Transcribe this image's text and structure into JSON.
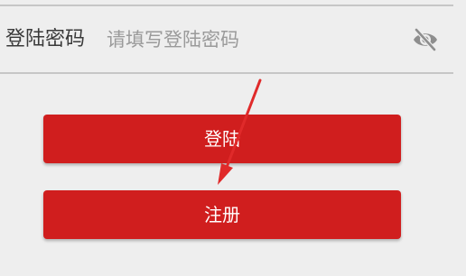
{
  "password_row": {
    "label": "登陆密码",
    "input_value": "",
    "placeholder": "请填写登陆密码",
    "toggle_icon": "eye-off-icon"
  },
  "buttons": {
    "login_label": "登陆",
    "register_label": "注册"
  },
  "annotation": {
    "icon": "red-arrow",
    "color": "#e02a2a"
  },
  "colors": {
    "primary_button": "#d01e1e",
    "background": "#eeeeee",
    "divider": "#c6c6c6"
  }
}
